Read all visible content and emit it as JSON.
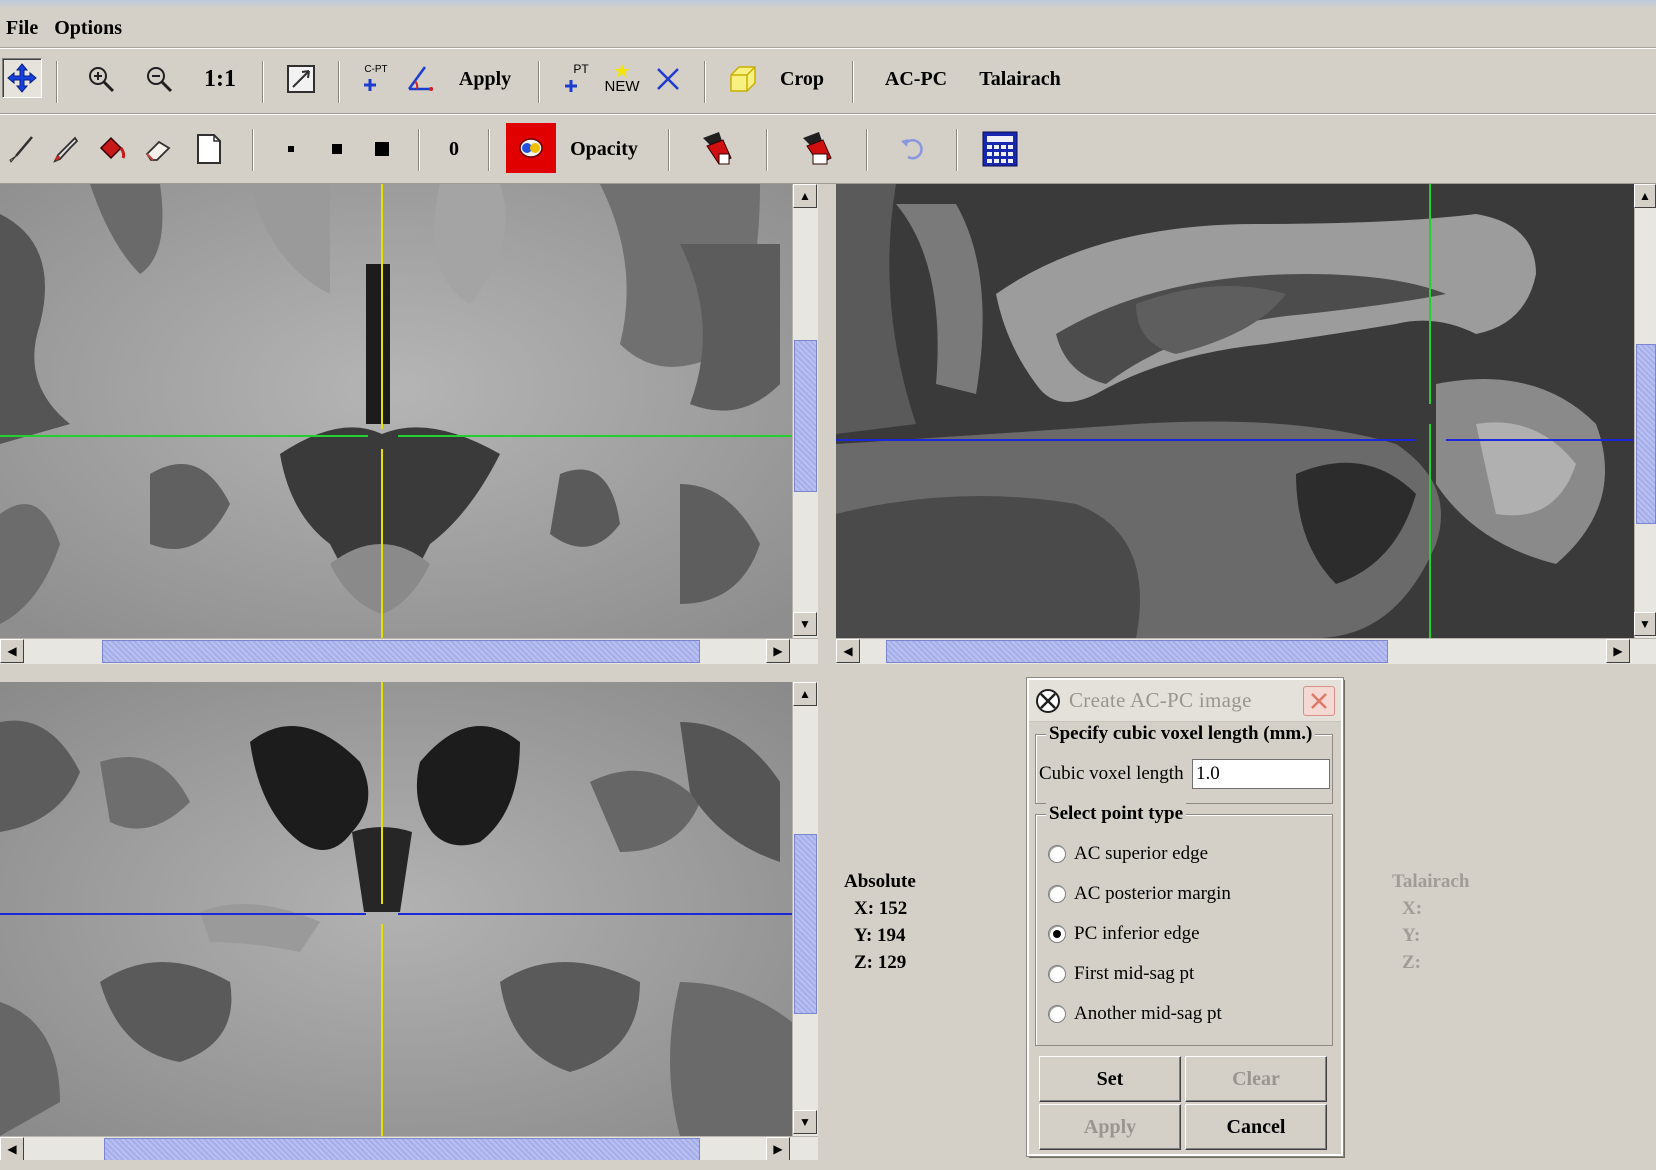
{
  "menu": {
    "file": "File",
    "options": "Options"
  },
  "toolbar1": {
    "fit_label": "1:1",
    "apply_label": "Apply",
    "crop_label": "Crop",
    "acpc_label": "AC-PC",
    "talairach_label": "Talairach",
    "cpt_badge": "C-PT",
    "pt_badge": "PT",
    "new_badge": "NEW"
  },
  "toolbar2": {
    "intensity_value": "0",
    "opacity_label": "Opacity"
  },
  "absolute": {
    "heading": "Absolute",
    "x": "X: 152",
    "y": "Y: 194",
    "z": "Z: 129"
  },
  "talairach": {
    "heading": "Talairach",
    "x": "X:",
    "y": "Y:",
    "z": "Z:"
  },
  "dialog": {
    "title": "Create AC-PC image",
    "voxel_group": "Specify cubic voxel length (mm.)",
    "voxel_label": "Cubic voxel length",
    "voxel_value": "1.0",
    "point_group": "Select point type",
    "options": [
      {
        "label": "AC superior edge",
        "selected": false
      },
      {
        "label": "AC posterior margin",
        "selected": false
      },
      {
        "label": "PC inferior edge",
        "selected": true
      },
      {
        "label": "First mid-sag pt",
        "selected": false
      },
      {
        "label": "Another mid-sag pt",
        "selected": false
      }
    ],
    "set_label": "Set",
    "clear_label": "Clear",
    "apply_label": "Apply",
    "cancel_label": "Cancel"
  },
  "colors": {
    "crosshair_vertical": "#e8e000",
    "crosshair_green": "#22d030",
    "crosshair_blue": "#1c28d8",
    "scroll_thumb": "#a6aeea",
    "paint_red": "#e00000"
  },
  "icons": [
    "move-icon",
    "zoom-in-icon",
    "zoom-out-icon",
    "reset-view-icon",
    "c-pt-icon",
    "angle-icon",
    "pt-icon",
    "new-voi-icon",
    "delete-point-icon",
    "crop-box-icon",
    "paintbrush-icon",
    "dropper-icon",
    "paint-bucket-icon",
    "eraser-icon",
    "blank-page-icon",
    "paint-color-icon",
    "commit-paint-icon",
    "commit-paint-alt-icon",
    "undo-icon",
    "calculator-icon"
  ]
}
